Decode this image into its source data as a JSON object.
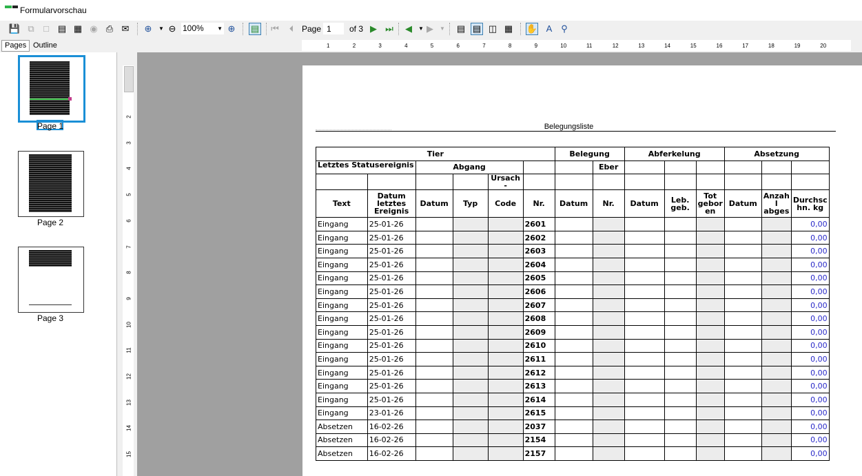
{
  "window": {
    "title": "Formularvorschau"
  },
  "toolbar": {
    "zoom_value": "100%",
    "page_label": "Page",
    "page_value": "1",
    "of_label": "of 3"
  },
  "tabs": {
    "pages": "Pages",
    "outline": "Outline"
  },
  "thumbnails": [
    {
      "label": "Page 1"
    },
    {
      "label": "Page 2"
    },
    {
      "label": "Page 3"
    }
  ],
  "ruler": {
    "h_ticks": [
      "1",
      "2",
      "3",
      "4",
      "5",
      "6",
      "7",
      "8",
      "9",
      "10",
      "11",
      "12",
      "13",
      "14",
      "15",
      "16",
      "17",
      "18",
      "19",
      "20"
    ],
    "v_ticks": [
      "2",
      "3",
      "4",
      "5",
      "6",
      "7",
      "8",
      "9",
      "10",
      "11",
      "12",
      "13",
      "14",
      "15"
    ]
  },
  "report": {
    "title": "Belegungsliste",
    "groups": {
      "tier": "Tier",
      "belegung": "Belegung",
      "abferkelung": "Abferkelung",
      "absetzung": "Absetzung"
    },
    "sub": {
      "letztes": "Letztes Statusereignis",
      "abgang": "Abgang",
      "eber": "Eber",
      "ursache": "Ursach -"
    },
    "columns": [
      "Text",
      "Datum letztes Ereignis",
      "Datum",
      "Typ",
      "Code",
      "Nr.",
      "Datum",
      "Nr.",
      "Datum",
      "Leb. geb.",
      "Tot gebor en",
      "Datum",
      "Anzah l abges",
      "Durchsc hn. kg"
    ],
    "rows": [
      {
        "text": "Eingang",
        "date": "25-01-26",
        "nr": "2601",
        "val": "0,00"
      },
      {
        "text": "Eingang",
        "date": "25-01-26",
        "nr": "2602",
        "val": "0,00"
      },
      {
        "text": "Eingang",
        "date": "25-01-26",
        "nr": "2603",
        "val": "0,00"
      },
      {
        "text": "Eingang",
        "date": "25-01-26",
        "nr": "2604",
        "val": "0,00"
      },
      {
        "text": "Eingang",
        "date": "25-01-26",
        "nr": "2605",
        "val": "0,00"
      },
      {
        "text": "Eingang",
        "date": "25-01-26",
        "nr": "2606",
        "val": "0,00"
      },
      {
        "text": "Eingang",
        "date": "25-01-26",
        "nr": "2607",
        "val": "0,00"
      },
      {
        "text": "Eingang",
        "date": "25-01-26",
        "nr": "2608",
        "val": "0,00"
      },
      {
        "text": "Eingang",
        "date": "25-01-26",
        "nr": "2609",
        "val": "0,00"
      },
      {
        "text": "Eingang",
        "date": "25-01-26",
        "nr": "2610",
        "val": "0,00"
      },
      {
        "text": "Eingang",
        "date": "25-01-26",
        "nr": "2611",
        "val": "0,00"
      },
      {
        "text": "Eingang",
        "date": "25-01-26",
        "nr": "2612",
        "val": "0,00"
      },
      {
        "text": "Eingang",
        "date": "25-01-26",
        "nr": "2613",
        "val": "0,00"
      },
      {
        "text": "Eingang",
        "date": "25-01-26",
        "nr": "2614",
        "val": "0,00"
      },
      {
        "text": "Eingang",
        "date": "23-01-26",
        "nr": "2615",
        "val": "0,00"
      },
      {
        "text": "Absetzen",
        "date": "16-02-26",
        "nr": "2037",
        "val": "0,00"
      },
      {
        "text": "Absetzen",
        "date": "16-02-26",
        "nr": "2154",
        "val": "0,00"
      },
      {
        "text": "Absetzen",
        "date": "16-02-26",
        "nr": "2157",
        "val": "0,00"
      }
    ]
  },
  "colors": {
    "accent": "#1a8fd6",
    "value_blue": "#2828c8",
    "viewer_bg": "#a0a0a0"
  }
}
